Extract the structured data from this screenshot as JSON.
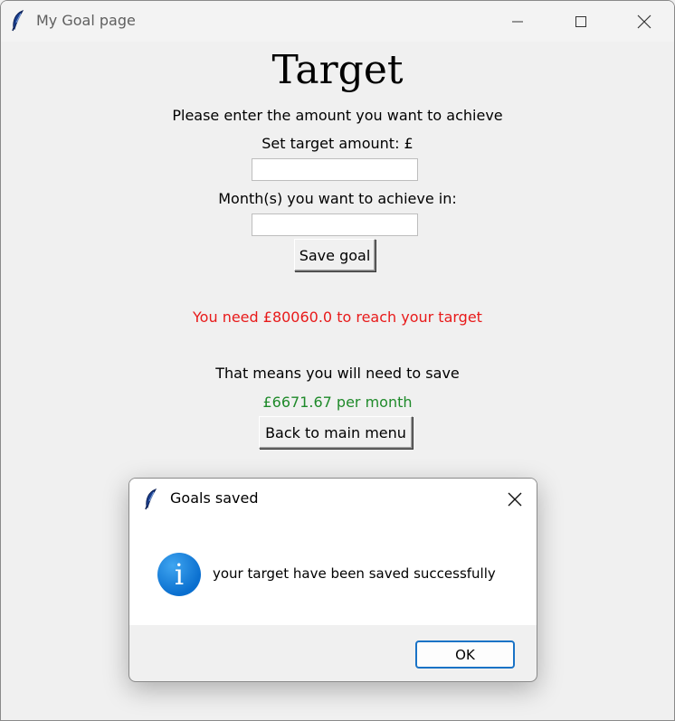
{
  "window": {
    "title": "My Goal page"
  },
  "page": {
    "heading": "Target",
    "instruction": "Please enter the amount you want to achieve",
    "target_label": "Set target amount: £",
    "target_value": "",
    "months_label": "Month(s) you want to achieve in:",
    "months_value": "",
    "save_button": "Save goal",
    "need_message": "You need £80060.0 to reach your target",
    "save_intro": "That means you will need to save",
    "per_month": "£6671.67 per month",
    "back_button": "Back to main menu"
  },
  "dialog": {
    "title": "Goals saved",
    "message": "your target have been saved successfully",
    "ok_button": "OK",
    "icon": "info-icon"
  },
  "colors": {
    "error_text": "#e81a1a",
    "success_text": "#1f8a2a",
    "accent": "#1a73c6"
  }
}
